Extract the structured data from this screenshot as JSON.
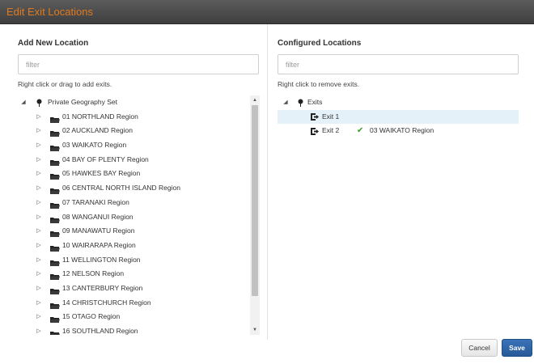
{
  "window": {
    "title": "Edit Exit Locations"
  },
  "left": {
    "heading": "Add New Location",
    "filter_placeholder": "filter",
    "hint": "Right click or drag to add exits.",
    "root_label": "Private Geography Set",
    "items": [
      "01 NORTHLAND Region",
      "02 AUCKLAND Region",
      "03 WAIKATO Region",
      "04 BAY OF PLENTY Region",
      "05 HAWKES BAY Region",
      "06 CENTRAL NORTH ISLAND Region",
      "07 TARANAKI Region",
      "08 WANGANUI Region",
      "09 MANAWATU Region",
      "10 WAIRARAPA Region",
      "11 WELLINGTON Region",
      "12 NELSON Region",
      "13 CANTERBURY Region",
      "14 CHRISTCHURCH Region",
      "15 OTAGO Region",
      "16 SOUTHLAND Region"
    ]
  },
  "right": {
    "heading": "Configured Locations",
    "filter_placeholder": "filter",
    "hint": "Right click to remove exits.",
    "root_label": "Exits",
    "exits": [
      {
        "label": "Exit 1",
        "location": ""
      },
      {
        "label": "Exit 2",
        "location": "03 WAIKATO Region"
      }
    ]
  },
  "buttons": {
    "cancel": "Cancel",
    "save": "Save"
  },
  "colors": {
    "title": "#e07a1f",
    "selection": "#e4f1f9",
    "save": "#2f66a8",
    "check": "#3a9a2e"
  }
}
